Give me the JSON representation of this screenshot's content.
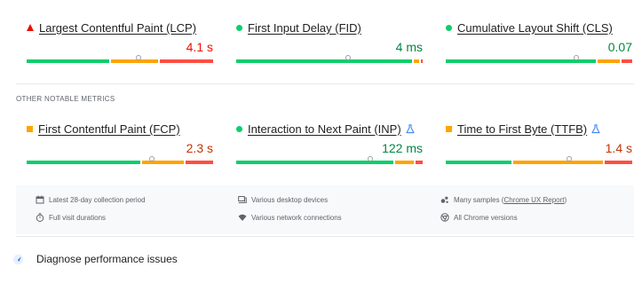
{
  "core_metrics": [
    {
      "label": "Largest Contentful Paint (LCP)",
      "value": "4.1 s",
      "status": "poor",
      "indicator": "triangle",
      "value_color": "#eb0f00",
      "distribution": {
        "good": 0.45,
        "needs_improvement": 0.26,
        "poor": 0.29
      },
      "marker": 0.6,
      "experimental": false
    },
    {
      "label": "First Input Delay (FID)",
      "value": "4 ms",
      "status": "good",
      "indicator": "circle",
      "value_color": "#018642",
      "distribution": {
        "good": 0.96,
        "needs_improvement": 0.03,
        "poor": 0.01
      },
      "marker": 0.6,
      "experimental": false
    },
    {
      "label": "Cumulative Layout Shift (CLS)",
      "value": "0.07",
      "status": "good",
      "indicator": "circle",
      "value_color": "#018642",
      "distribution": {
        "good": 0.82,
        "needs_improvement": 0.12,
        "poor": 0.06
      },
      "marker": 0.7,
      "experimental": false
    }
  ],
  "other_section_title": "OTHER NOTABLE METRICS",
  "other_metrics": [
    {
      "label": "First Contentful Paint (FCP)",
      "value": "2.3 s",
      "status": "needs-improvement",
      "indicator": "square",
      "value_color": "#c33300",
      "distribution": {
        "good": 0.62,
        "needs_improvement": 0.23,
        "poor": 0.15
      },
      "marker": 0.67,
      "experimental": false
    },
    {
      "label": "Interaction to Next Paint (INP)",
      "value": "122 ms",
      "status": "good",
      "indicator": "circle",
      "value_color": "#018642",
      "distribution": {
        "good": 0.86,
        "needs_improvement": 0.1,
        "poor": 0.04
      },
      "marker": 0.72,
      "experimental": true
    },
    {
      "label": "Time to First Byte (TTFB)",
      "value": "1.4 s",
      "status": "needs-improvement",
      "indicator": "square",
      "value_color": "#c33300",
      "distribution": {
        "good": 0.36,
        "needs_improvement": 0.49,
        "poor": 0.15
      },
      "marker": 0.66,
      "experimental": true
    }
  ],
  "info": {
    "collection_period": "Latest 28-day collection period",
    "visit_durations": "Full visit durations",
    "devices": "Various desktop devices",
    "connections": "Various network connections",
    "samples_prefix": "Many samples (",
    "samples_link": "Chrome UX Report",
    "samples_suffix": ")",
    "chrome_versions": "All Chrome versions"
  },
  "diagnose_label": "Diagnose performance issues",
  "colors": {
    "good": "#0cce6b",
    "needs_improvement": "#ffa400",
    "poor": "#ff4e42",
    "poor_text": "#eb0f00",
    "average_text": "#c33300",
    "good_text": "#018642"
  },
  "icons": [
    "calendar-icon",
    "stopwatch-icon",
    "desktop-icon",
    "wifi-icon",
    "samples-icon",
    "chrome-icon",
    "flask-icon",
    "diagnose-icon"
  ]
}
